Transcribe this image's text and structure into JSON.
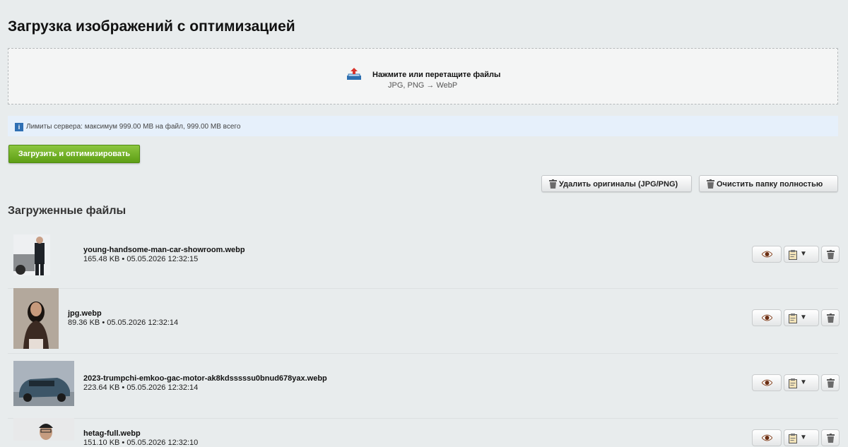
{
  "page": {
    "title": "Загрузка изображений с оптимизацией"
  },
  "dropzone": {
    "title": "Нажмите или перетащите файлы",
    "subtitle": "JPG, PNG → WebP"
  },
  "limits": {
    "text": "Лимиты сервера: максимум 999.00 MB на файл, 999.00 MB всего"
  },
  "upload_button": "Загрузить и оптимизировать",
  "toolbar": {
    "delete_originals": "Удалить оригиналы (JPG/PNG)",
    "clear_folder": "Очистить папку полностью"
  },
  "files_section": {
    "title": "Загруженные файлы"
  },
  "files": [
    {
      "name": "young-handsome-man-car-showroom.webp",
      "meta": "165.48 KB • 05.05.2026 12:32:15"
    },
    {
      "name": "jpg.webp",
      "meta": "89.36 KB • 05.05.2026 12:32:14"
    },
    {
      "name": "2023-trumpchi-emkoo-gac-motor-ak8kdsssssu0bnud678yax.webp",
      "meta": "223.64 KB • 05.05.2026 12:32:14"
    },
    {
      "name": "hetag-full.webp",
      "meta": "151.10 KB • 05.05.2026 12:32:10"
    }
  ],
  "colors": {
    "accent_green": "#6fb02a",
    "info_blue": "#2f6fb3",
    "background": "#e8eced"
  },
  "icons": {
    "upload": "upload-tray-icon",
    "info": "info-icon",
    "view": "eye-icon",
    "copy": "clipboard-icon",
    "delete": "trash-icon"
  }
}
